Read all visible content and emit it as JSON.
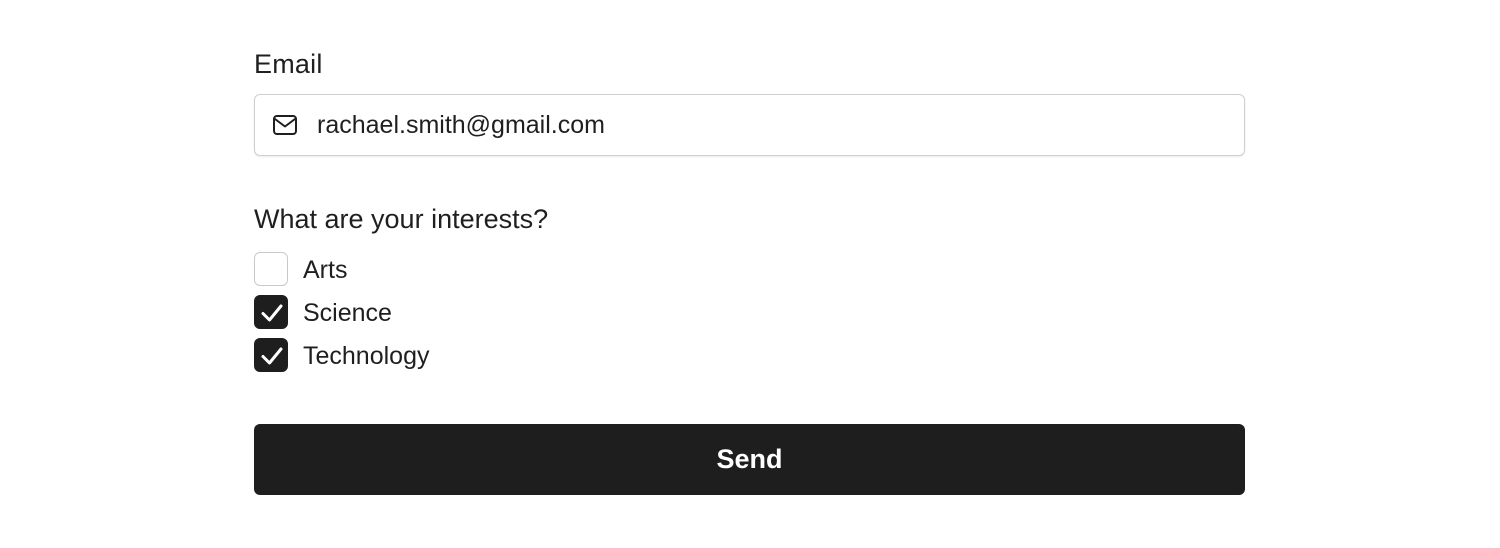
{
  "email": {
    "label": "Email",
    "value": "rachael.smith@gmail.com",
    "icon": "mail-icon"
  },
  "interests": {
    "question": "What are your interests?",
    "options": [
      {
        "label": "Arts",
        "checked": false
      },
      {
        "label": "Science",
        "checked": true
      },
      {
        "label": "Technology",
        "checked": true
      }
    ]
  },
  "send_label": "Send",
  "colors": {
    "button_bg": "#1e1e1e",
    "checkbox_checked": "#1e1e1e",
    "input_border": "#cfcfcf"
  }
}
